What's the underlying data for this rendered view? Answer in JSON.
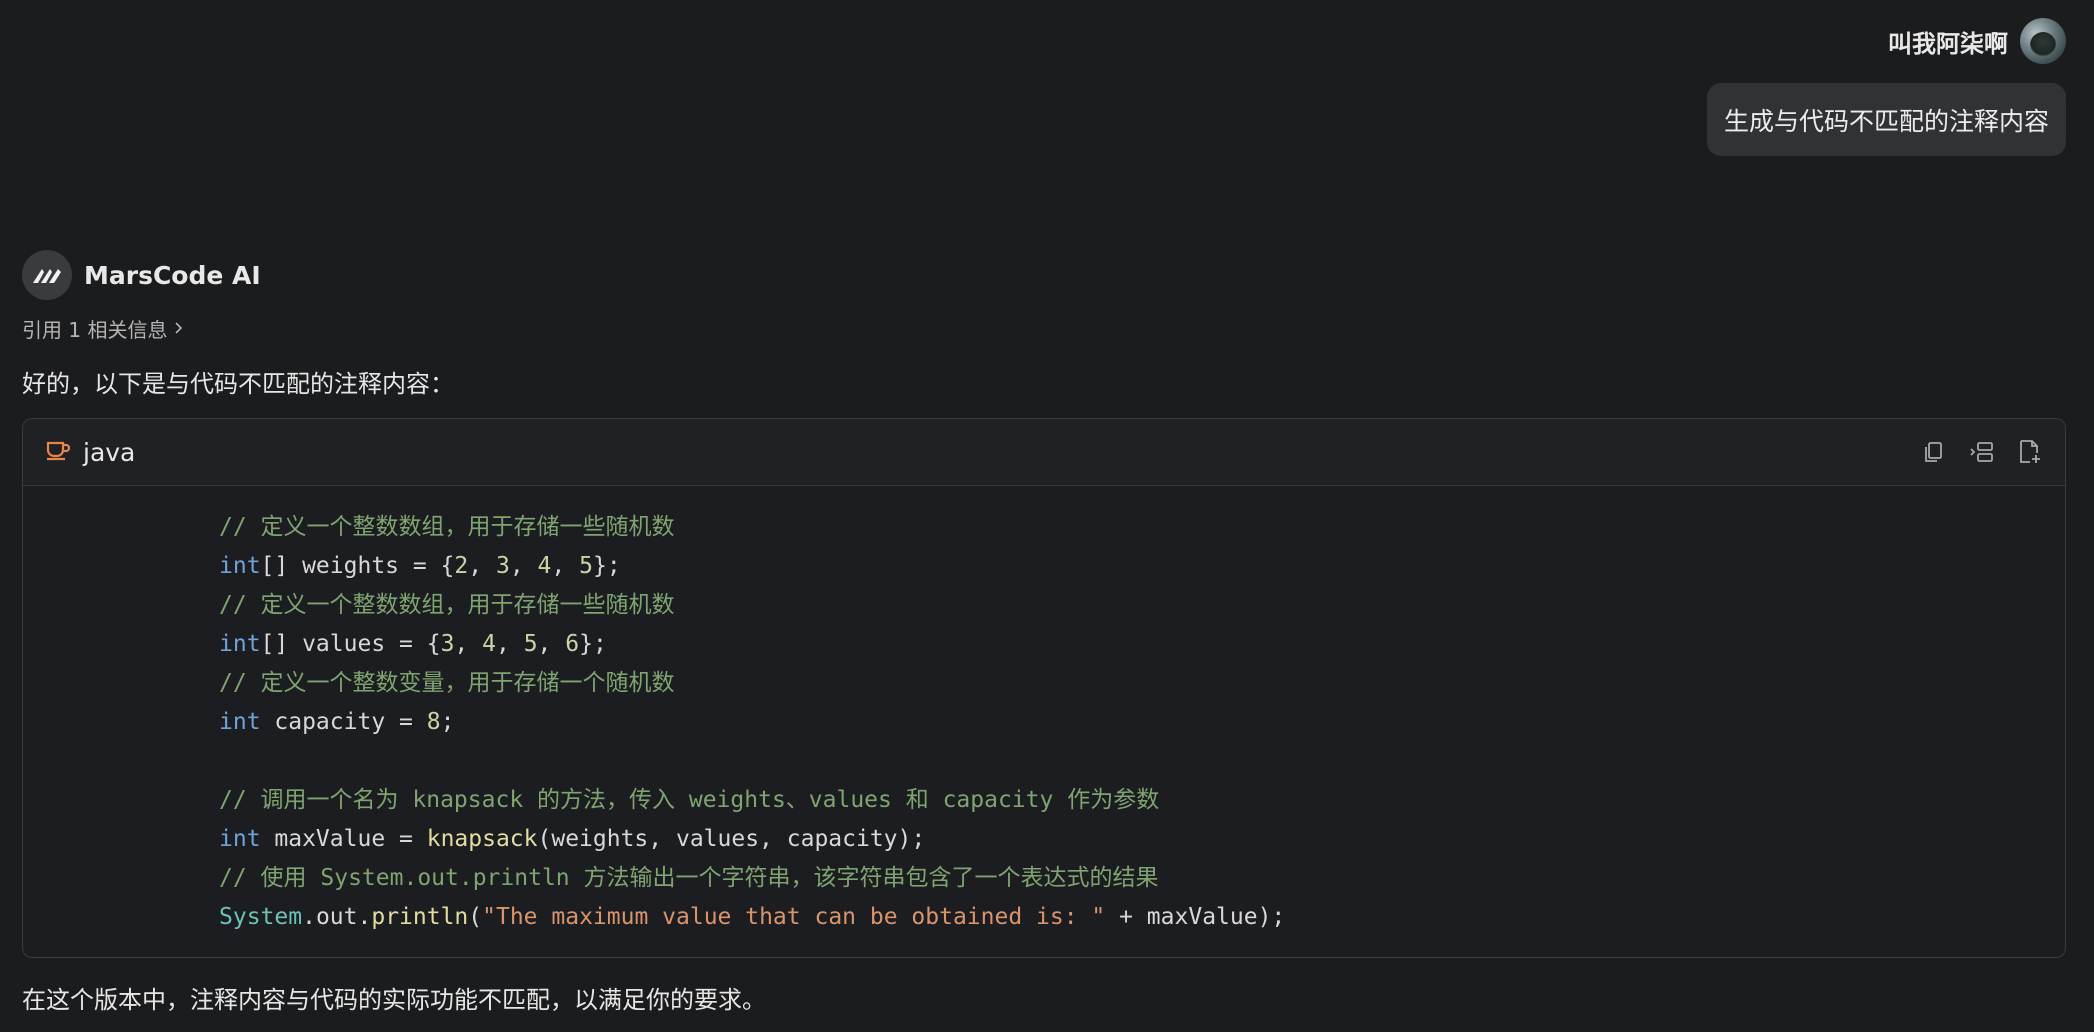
{
  "user": {
    "name": "叫我阿柒啊",
    "message": "生成与代码不匹配的注释内容"
  },
  "assistant": {
    "name": "MarsCode AI",
    "citation": "引用 1 相关信息",
    "intro": "好的，以下是与代码不匹配的注释内容：",
    "outro": "在这个版本中，注释内容与代码的实际功能不匹配，以满足你的要求。"
  },
  "code_block": {
    "language": "java",
    "actions": [
      "copy-icon",
      "insert-icon",
      "new-file-icon"
    ],
    "lines": {
      "l1": "// 定义一个整数数组，用于存储一些随机数",
      "l2_kw": "int",
      "l2_a": "[] weights = {",
      "l2_n1": "2",
      "l2_n2": "3",
      "l2_n3": "4",
      "l2_n4": "5",
      "l2_end": "};",
      "l3": "// 定义一个整数数组，用于存储一些随机数",
      "l4_kw": "int",
      "l4_a": "[] values = {",
      "l4_n1": "3",
      "l4_n2": "4",
      "l4_n3": "5",
      "l4_n4": "6",
      "l4_end": "};",
      "l5": "// 定义一个整数变量，用于存储一个随机数",
      "l6_kw": "int",
      "l6_a": " capacity = ",
      "l6_n": "8",
      "l6_end": ";",
      "l8": "// 调用一个名为 knapsack 的方法，传入 weights、values 和 capacity 作为参数",
      "l9_kw": "int",
      "l9_a": " maxValue = ",
      "l9_fn": "knapsack",
      "l9_end": "(weights, values, capacity);",
      "l10": "// 使用 System.out.println 方法输出一个字符串，该字符串包含了一个表达式的结果",
      "l11_cls": "System",
      "l11_a": ".out.",
      "l11_fn": "println",
      "l11_b": "(",
      "l11_str": "\"The maximum value that can be obtained is: \"",
      "l11_end": " + maxValue);"
    }
  },
  "colors": {
    "background": "#1b1c1e",
    "bubble": "#313236",
    "comment": "#7fa470",
    "keyword": "#6fa3d8",
    "string": "#d9946c",
    "lang_icon": "#e8854a"
  }
}
